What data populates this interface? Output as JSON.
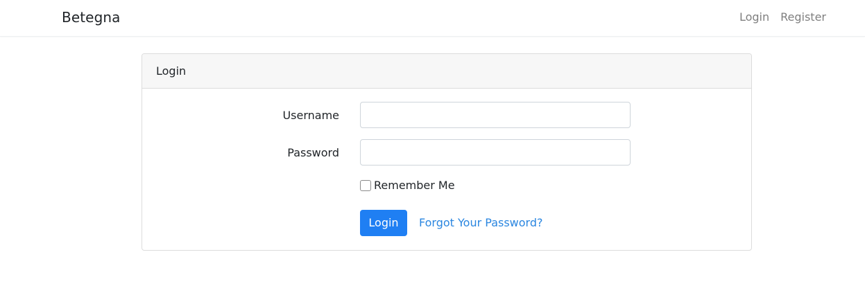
{
  "navbar": {
    "brand": "Betegna",
    "links": [
      "Login",
      "Register"
    ]
  },
  "card": {
    "header": "Login",
    "username_label": "Username",
    "username_value": "",
    "password_label": "Password",
    "password_value": "",
    "remember_label": "Remember Me",
    "remember_checked": false,
    "login_button": "Login",
    "forgot_link": "Forgot Your Password?"
  },
  "colors": {
    "primary": "#1f7ff3",
    "link": "#2a86e0",
    "header_bg": "#f7f7f7"
  }
}
